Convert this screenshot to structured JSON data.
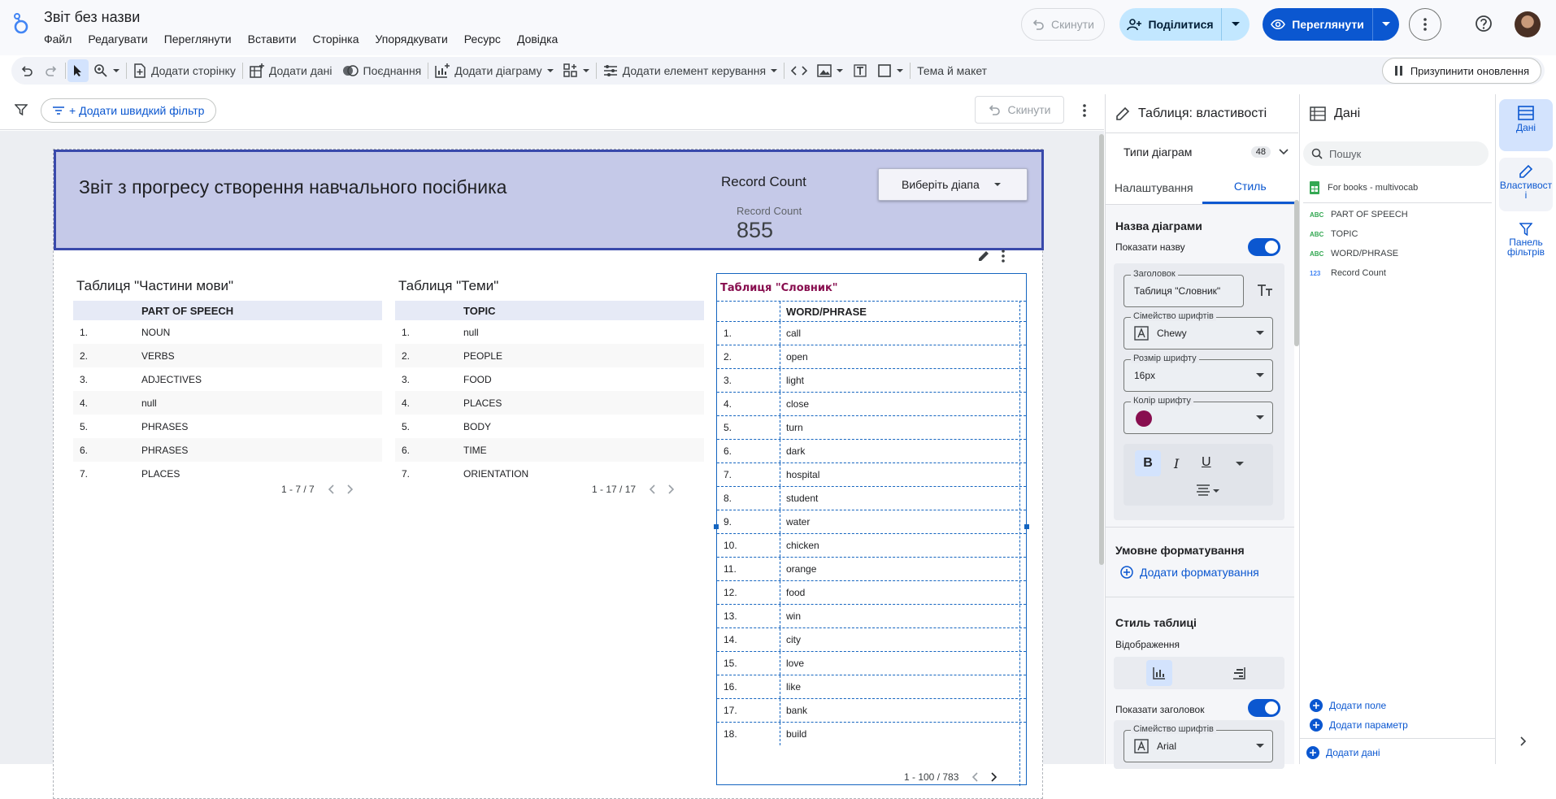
{
  "app": {
    "title": "Звіт без назви",
    "menu": [
      "Файл",
      "Редагувати",
      "Переглянути",
      "Вставити",
      "Сторінка",
      "Упорядкувати",
      "Ресурс",
      "Довідка"
    ],
    "reset": "Скинути",
    "share": "Поділитися",
    "view": "Переглянути"
  },
  "toolbar": {
    "add_page": "Додати сторінку",
    "add_data": "Додати дані",
    "blend": "Поєднання",
    "add_chart": "Додати діаграму",
    "add_control": "Додати елемент керування",
    "theme": "Тема й макет",
    "pause": "Призупинити оновлення"
  },
  "filterbar": {
    "add_filter": "+ Додати швидкий фільтр",
    "reset": "Скинути"
  },
  "report": {
    "title": "Звіт з прогресу створення навчального посібника",
    "rc_title": "Record Count",
    "rc_label": "Record Count",
    "rc_value": "855",
    "date_range": "Виберіть діапа"
  },
  "pos": {
    "title": "Таблиця \"Частини мови\"",
    "header": "PART OF SPEECH",
    "rows": [
      {
        "n": "1.",
        "v": "NOUN"
      },
      {
        "n": "2.",
        "v": "VERBS"
      },
      {
        "n": "3.",
        "v": "ADJECTIVES"
      },
      {
        "n": "4.",
        "v": "null"
      },
      {
        "n": "5.",
        "v": "PHRASES"
      },
      {
        "n": "6.",
        "v": "PHRASES"
      },
      {
        "n": "7.",
        "v": "PLACES"
      }
    ],
    "pager": "1 - 7 / 7"
  },
  "topic": {
    "title": "Таблиця \"Теми\"",
    "header": "TOPIC",
    "rows": [
      {
        "n": "1.",
        "v": "null"
      },
      {
        "n": "2.",
        "v": "PEOPLE"
      },
      {
        "n": "3.",
        "v": "FOOD"
      },
      {
        "n": "4.",
        "v": "PLACES"
      },
      {
        "n": "5.",
        "v": "BODY"
      },
      {
        "n": "6.",
        "v": "TIME"
      },
      {
        "n": "7.",
        "v": "ORIENTATION"
      }
    ],
    "pager": "1 - 17 / 17"
  },
  "vocab": {
    "title": "Таблиця \"Словник\"",
    "header": "WORD/PHRASE",
    "rows": [
      {
        "n": "1.",
        "v": "call"
      },
      {
        "n": "2.",
        "v": "open"
      },
      {
        "n": "3.",
        "v": "light"
      },
      {
        "n": "4.",
        "v": "close"
      },
      {
        "n": "5.",
        "v": "turn"
      },
      {
        "n": "6.",
        "v": "dark"
      },
      {
        "n": "7.",
        "v": "hospital"
      },
      {
        "n": "8.",
        "v": "student"
      },
      {
        "n": "9.",
        "v": "water"
      },
      {
        "n": "10.",
        "v": "chicken"
      },
      {
        "n": "11.",
        "v": "orange"
      },
      {
        "n": "12.",
        "v": "food"
      },
      {
        "n": "13.",
        "v": "win"
      },
      {
        "n": "14.",
        "v": "city"
      },
      {
        "n": "15.",
        "v": "love"
      },
      {
        "n": "16.",
        "v": "like"
      },
      {
        "n": "17.",
        "v": "bank"
      },
      {
        "n": "18.",
        "v": "build"
      }
    ],
    "pager": "1 - 100 / 783"
  },
  "props": {
    "title": "Таблиця: властивості",
    "chart_types": "Типи діаграм",
    "chart_types_count": "48",
    "tab_setup": "Налаштування",
    "tab_style": "Стиль",
    "chart_title": "Назва діаграми",
    "show_title": "Показати назву",
    "title_lbl": "Заголовок",
    "title_val": "Таблиця \"Словник\"",
    "font_family_lbl": "Сімейство шрифтів",
    "font_family_val": "Chewy",
    "font_size_lbl": "Розмір шрифту",
    "font_size_val": "16px",
    "font_color_lbl": "Колір шрифту",
    "font_color": "#880e4f",
    "cond_format": "Умовне форматування",
    "add_format": "Додати форматування",
    "table_style": "Стиль таблиці",
    "display": "Відображення",
    "show_header": "Показати заголовок",
    "font_family_val2": "Arial"
  },
  "data": {
    "title": "Дані",
    "search": "Пошук",
    "source": "For books - multivocab",
    "fields": [
      {
        "type": "ABC",
        "name": "PART OF SPEECH"
      },
      {
        "type": "ABC",
        "name": "TOPIC"
      },
      {
        "type": "ABC",
        "name": "WORD/PHRASE"
      },
      {
        "type": "123",
        "name": "Record Count"
      }
    ],
    "add_field": "Додати поле",
    "add_param": "Додати параметр",
    "add_data": "Додати дані"
  },
  "rail": {
    "data": "Дані",
    "props": "Властивості",
    "filters": "Панель фільтрів"
  }
}
